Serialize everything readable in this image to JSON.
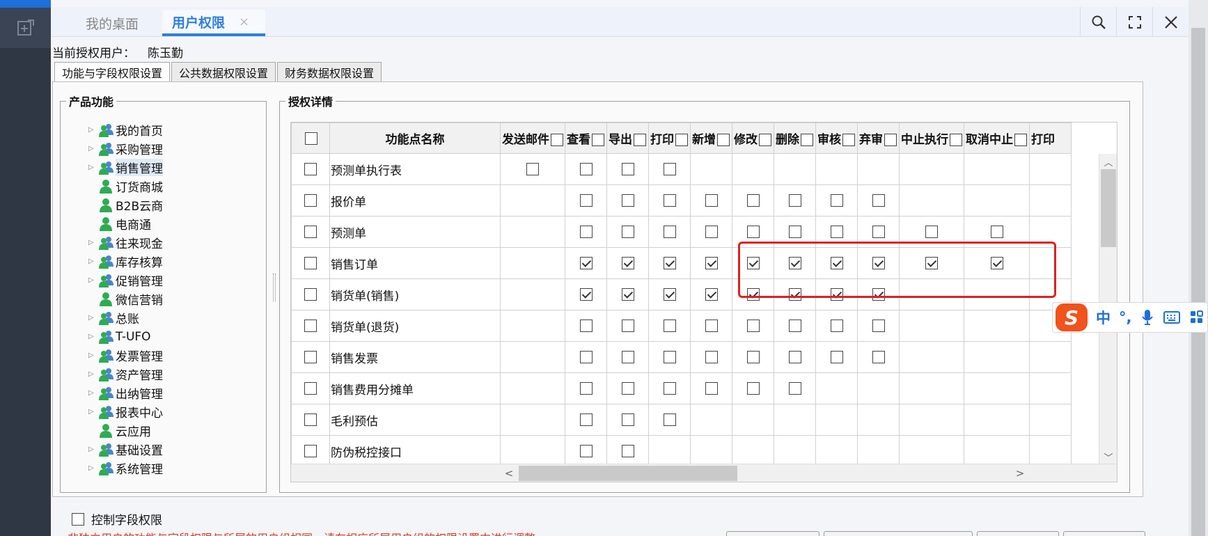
{
  "tabs": [
    {
      "label": "我的桌面"
    },
    {
      "label": "用户权限",
      "close": "×"
    }
  ],
  "current_user": {
    "label": "当前授权用户：",
    "name": "陈玉勤"
  },
  "subtabs": [
    "功能与字段权限设置",
    "公共数据权限设置",
    "财务数据权限设置"
  ],
  "left_panel": {
    "legend": "产品功能",
    "items": [
      {
        "label": "我的首页",
        "type": "group"
      },
      {
        "label": "采购管理",
        "type": "group"
      },
      {
        "label": "销售管理",
        "type": "group",
        "selected": true
      },
      {
        "label": "订货商城",
        "type": "leaf"
      },
      {
        "label": "B2B云商",
        "type": "leaf"
      },
      {
        "label": "电商通",
        "type": "leaf"
      },
      {
        "label": "往来现金",
        "type": "group"
      },
      {
        "label": "库存核算",
        "type": "group"
      },
      {
        "label": "促销管理",
        "type": "group"
      },
      {
        "label": "微信营销",
        "type": "leaf"
      },
      {
        "label": "总账",
        "type": "group"
      },
      {
        "label": "T-UFO",
        "type": "group"
      },
      {
        "label": "发票管理",
        "type": "group"
      },
      {
        "label": "资产管理",
        "type": "group"
      },
      {
        "label": "出纳管理",
        "type": "group"
      },
      {
        "label": "报表中心",
        "type": "group"
      },
      {
        "label": "云应用",
        "type": "leaf"
      },
      {
        "label": "基础设置",
        "type": "group"
      },
      {
        "label": "系统管理",
        "type": "group"
      }
    ]
  },
  "right_panel": {
    "legend": "授权详情",
    "name_header": "功能点名称",
    "columns": [
      "发送邮件",
      "查看",
      "导出",
      "打印",
      "新增",
      "修改",
      "删除",
      "审核",
      "弃审",
      "中止执行",
      "取消中止",
      "打印"
    ],
    "rows": [
      {
        "name": "预测单执行表",
        "cells": [
          0,
          0,
          0,
          0,
          null,
          null,
          null,
          null,
          null,
          null,
          null
        ]
      },
      {
        "name": "报价单",
        "cells": [
          null,
          0,
          0,
          0,
          0,
          0,
          0,
          0,
          0,
          null,
          null
        ]
      },
      {
        "name": "预测单",
        "cells": [
          null,
          0,
          0,
          0,
          0,
          0,
          0,
          0,
          0,
          0,
          0
        ]
      },
      {
        "name": "销售订单",
        "cells": [
          null,
          1,
          1,
          1,
          1,
          1,
          1,
          1,
          1,
          1,
          1
        ]
      },
      {
        "name": "销货单(销售)",
        "cells": [
          null,
          1,
          1,
          1,
          1,
          1,
          1,
          1,
          1,
          null,
          null
        ]
      },
      {
        "name": "销货单(退货)",
        "cells": [
          null,
          0,
          0,
          0,
          0,
          0,
          0,
          0,
          0,
          null,
          null
        ]
      },
      {
        "name": "销售发票",
        "cells": [
          null,
          0,
          0,
          0,
          0,
          0,
          0,
          0,
          0,
          null,
          null
        ]
      },
      {
        "name": "销售费用分摊单",
        "cells": [
          null,
          0,
          0,
          0,
          0,
          0,
          0,
          null,
          null,
          null,
          null
        ]
      },
      {
        "name": "毛利预估",
        "cells": [
          null,
          0,
          0,
          0,
          null,
          null,
          null,
          null,
          null,
          null,
          null
        ]
      },
      {
        "name": "防伪税控接口",
        "cells": [
          null,
          0,
          0,
          null,
          null,
          null,
          null,
          null,
          null,
          null,
          null
        ]
      }
    ]
  },
  "ime": {
    "lang": "中",
    "punct": "°,"
  },
  "footer": {
    "control_field_label": "控制字段权限",
    "warning": "非独立用户的功能与字段权限与所属的用户组相同，请在相应所属用户组的权限设置中进行调整;"
  },
  "colors": {
    "accent": "#2d7fe0",
    "highlight": "#e02020",
    "warning": "#d23a1e"
  }
}
